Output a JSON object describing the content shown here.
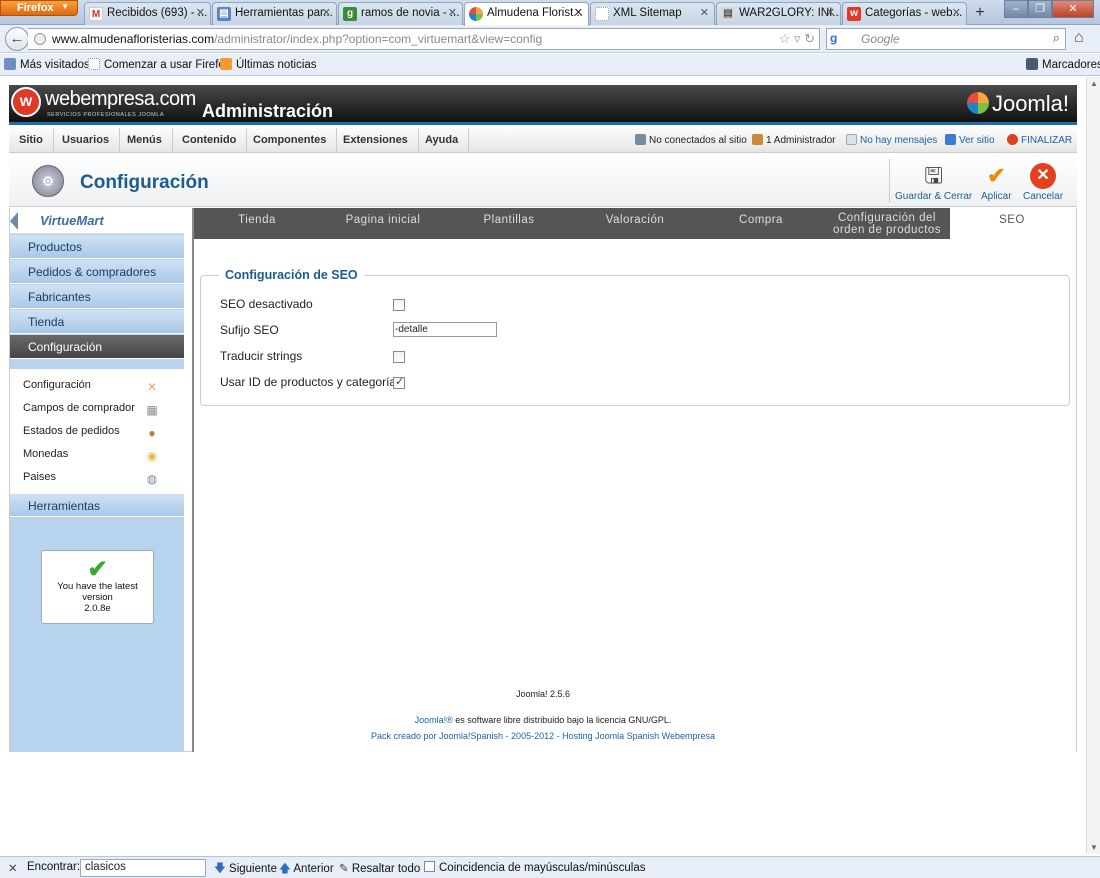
{
  "browser": {
    "menu_button": "Firefox",
    "tabs": [
      {
        "title": "Recibidos (693) - ...",
        "icon": "gmail-icon"
      },
      {
        "title": "Herramientas par...",
        "icon": "page-icon"
      },
      {
        "title": "ramos de novia - ...",
        "icon": "google-icon"
      },
      {
        "title": "Almudena Florist...",
        "icon": "joomla-icon"
      },
      {
        "title": "XML Sitemap",
        "icon": "blank-page-icon"
      },
      {
        "title": "WAR2GLORY: INI...",
        "icon": "page-icon"
      },
      {
        "title": "Categorías - web...",
        "icon": "webempresa-icon"
      }
    ],
    "url_host": "www.almudenafloristerias.com",
    "url_path": "/administrator/index.php?option=com_virtuemart&view=config",
    "search_placeholder": "Google",
    "bookmarks": [
      "Más visitados",
      "Comenzar a usar Firefox",
      "Últimas noticias"
    ],
    "bookmarks_menu": "Marcadores"
  },
  "header": {
    "brand": "webempresa.com",
    "brand_sub": "SERVICIOS PROFESIONALES JOOMLA",
    "title": "Administración",
    "joomla_logo": "Joomla!"
  },
  "menu": {
    "items": [
      "Sitio",
      "Usuarios",
      "Menús",
      "Contenido",
      "Componentes",
      "Extensiones",
      "Ayuda"
    ],
    "status": {
      "not_connected": "No conectados al sitio",
      "admins": "1 Administrador",
      "messages": "No hay mensajes",
      "view_site": "Ver sitio",
      "logout": "FINALIZAR"
    }
  },
  "toolbar": {
    "title": "Configuración",
    "buttons": {
      "save_close": "Guardar & Cerrar",
      "apply": "Aplicar",
      "cancel": "Cancelar"
    }
  },
  "sidebar": {
    "logo": "VirtueMart",
    "sections": [
      "Productos",
      "Pedidos & compradores",
      "Fabricantes",
      "Tienda",
      "Configuración"
    ],
    "subitems": [
      "Configuración",
      "Campos de comprador",
      "Estados de pedidos",
      "Monedas",
      "Paises"
    ],
    "tools": "Herramientas",
    "version_line1": "You have the latest",
    "version_line2": "version",
    "version_number": "2.0.8e"
  },
  "tabs": {
    "items": [
      "Tienda",
      "Pagina inicial",
      "Plantillas",
      "Valoración",
      "Compra"
    ],
    "order_line1": "Configuración del",
    "order_line2": "orden de productos",
    "seo": "SEO"
  },
  "seo": {
    "legend": "Configuración de SEO",
    "fields": {
      "disabled": {
        "label": "SEO desactivado",
        "checked": false
      },
      "suffix": {
        "label": "Sufijo SEO",
        "value": "-detalle"
      },
      "translate": {
        "label": "Traducir strings",
        "checked": false
      },
      "use_id": {
        "label": "Usar ID de productos y categorías",
        "checked": true
      }
    }
  },
  "footer": {
    "version": "Joomla! 2.5.6",
    "license_link": "Joomla!®",
    "license_text": " es software libre distribuido bajo la licencia GNU/GPL.",
    "pack": "Pack creado por Joomla!Spanish - 2005-2012 - Hosting Joomla Spanish Webempresa"
  },
  "findbar": {
    "label": "Encontrar:",
    "value": "clasicos",
    "next": "Siguiente",
    "prev": "Anterior",
    "highlight": "Resaltar todo",
    "match_case": "Coincidencia de mayúsculas/minúsculas"
  }
}
